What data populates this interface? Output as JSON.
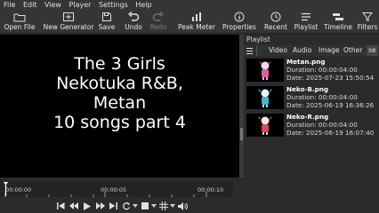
{
  "menu": [
    "File",
    "Edit",
    "View",
    "Player",
    "Settings",
    "Help"
  ],
  "toolbar": {
    "open_file": "Open File",
    "open_generator": "New Generator",
    "save": "Save",
    "undo": "Undo",
    "redo": "Redo",
    "peak_meter": "Peak Meter",
    "properties": "Properties",
    "recent": "Recent",
    "playlist": "Playlist",
    "timeline": "Timeline",
    "filters": "Filters"
  },
  "player": {
    "title_lines": [
      "The 3 Girls",
      "Nekotuka R&B,",
      "Metan",
      "10 songs part 4"
    ]
  },
  "playlist": {
    "title": "Playlist",
    "tabs": [
      "Video",
      "Audio",
      "Image",
      "Other",
      "se"
    ],
    "items": [
      {
        "name": "Metan.png",
        "duration": "Duration: 00:00:04:00",
        "date": "Date: 2025-07-23 15:50:54",
        "accent": "#e05fa8"
      },
      {
        "name": "Neko-B.png",
        "duration": "Duration: 00:00:04:00",
        "date": "Date: 2025-06-19 16:36:26",
        "accent": "#3fb7d9"
      },
      {
        "name": "Neko-R.png",
        "duration": "Duration: 00:00:04:00",
        "date": "Date: 2025-06-19 16:07:40",
        "accent": "#d94a5a"
      }
    ]
  },
  "ruler": {
    "t0": "00:00:00",
    "t1": "00:00:05",
    "t2": "00:00:10"
  },
  "colors": {
    "bg": "#2b2b2b",
    "toolbar": "#353535",
    "selected": "#3d6fb4",
    "playhead": "#ffffff"
  }
}
